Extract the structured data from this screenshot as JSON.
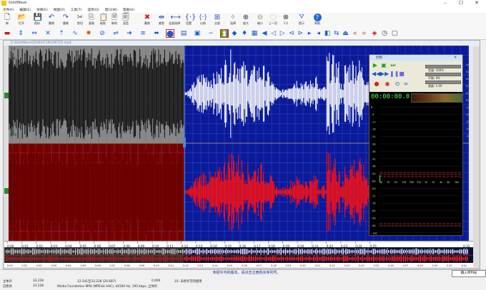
{
  "window": {
    "title": "GoldWave"
  },
  "menu": [
    "文件(F)",
    "编辑(E)",
    "效果(E)",
    "视图(V)",
    "工具(T)",
    "选项(O)",
    "窗口(W)",
    "帮助(H)"
  ],
  "toolbar1": [
    {
      "label": "新",
      "icon": "new-icon",
      "glyph": "🗋",
      "color": "#444"
    },
    {
      "label": "打开",
      "icon": "open-icon",
      "glyph": "📂",
      "color": "#c89020"
    },
    {
      "label": "保存",
      "icon": "save-icon",
      "glyph": "💾",
      "color": "#1a3a9a"
    },
    {
      "label": "撤销",
      "icon": "undo-icon",
      "glyph": "↶",
      "color": "#2a5ab0"
    },
    {
      "label": "重做",
      "icon": "redo-icon",
      "glyph": "↷",
      "color": "#2a5ab0"
    },
    {
      "label": "剪切",
      "icon": "cut-icon",
      "glyph": "✂",
      "color": "#555"
    },
    {
      "label": "复制",
      "icon": "copy-icon",
      "glyph": "⎘",
      "color": "#555"
    },
    {
      "label": "粘贴",
      "icon": "paste-icon",
      "glyph": "📋",
      "color": "#666"
    },
    {
      "label": "新的",
      "icon": "paste-new-icon",
      "glyph": "🗎",
      "color": "#666"
    },
    {
      "label": "混音",
      "icon": "mix-icon",
      "glyph": "🗐",
      "color": "#666"
    },
    {
      "label": "删除",
      "icon": "delete-icon",
      "glyph": "✖",
      "color": "#d02020"
    },
    {
      "label": "裁剪",
      "icon": "trim-icon",
      "glyph": "⇹",
      "color": "#2050c0"
    },
    {
      "label": "全部选择",
      "icon": "select-all-icon",
      "glyph": "⟷",
      "color": "#2050c0"
    },
    {
      "label": "设置",
      "icon": "set-icon",
      "glyph": "{·}",
      "color": "#2050c0"
    },
    {
      "label": "以前",
      "icon": "previous-icon",
      "glyph": "⟨·⟩",
      "color": "#2050c0"
    },
    {
      "label": "全部",
      "icon": "all-icon",
      "glyph": "⊞",
      "color": "#2050c0"
    },
    {
      "label": "选择",
      "icon": "select-icon",
      "glyph": "✧",
      "color": "#888"
    },
    {
      "label": "放大",
      "icon": "zoom-in-icon",
      "glyph": "⊕",
      "color": "#333"
    },
    {
      "label": "缩小",
      "icon": "zoom-out-icon",
      "glyph": "⊖",
      "color": "#888"
    },
    {
      "label": "上一页",
      "icon": "page-up-icon",
      "glyph": "◌",
      "color": "#aaa"
    },
    {
      "label": "1:1",
      "icon": "zoom-one-icon",
      "glyph": "⊗",
      "color": "#333"
    },
    {
      "label": "提示",
      "icon": "cue-icon",
      "glyph": "⛛",
      "color": "#2a6ad0"
    },
    {
      "label": "帮助",
      "icon": "help-icon",
      "glyph": "?",
      "color": "#fff"
    }
  ],
  "toolbar2_icons": [
    "record-icon",
    "stereo-icon",
    "channel-icon",
    "noise-icon",
    "pitch-icon",
    "loop-icon",
    "equalizer-icon",
    "filter-icon",
    "flip-icon",
    "play-right-icon",
    "mix-bars-icon",
    "compress-icon",
    "fade-icon",
    "volume-bars-icon",
    "level-icon",
    "wave-icon",
    "split-icon",
    "marker-icon",
    "shape-icon",
    "spectrum-icon",
    "speaker-icon",
    "speaker-left-icon",
    "speaker-right-icon",
    "mute-icon",
    "mono-icon",
    "left-icon",
    "right-icon",
    "swap-icon",
    "reverse-icon",
    "eject-icon",
    "back-icon",
    "forward-icon",
    "diamond-icon",
    "timer-icon",
    "stop-icon"
  ],
  "document": {
    "title": "E:\\GoldWave\\2019\\0719\\190725.mp4"
  },
  "control": {
    "title": "控制",
    "volume_label": "音量: 100%",
    "balance_label": "平衡: 0%",
    "speed_label": "速度: 1.00",
    "time": "00:00:00.0"
  },
  "wave": {
    "left_ticks": [
      "1.0",
      "0.8",
      "0.6",
      "0.4",
      "0.2",
      "0.0",
      "-0.2",
      "-0.4",
      "-0.6",
      "-0.8"
    ],
    "right_ticks": [
      "1.0",
      "0.8",
      "0.6",
      "0.4",
      "0.2",
      "0.0",
      "-0.2",
      "-0.4",
      "-0.6",
      "-0.8",
      "-1.0"
    ]
  },
  "meter": {
    "db_labels": [
      "0",
      "-6",
      "-12",
      "-18",
      "-24",
      "-30",
      "-36",
      "-42",
      "-48",
      "-54",
      "-60",
      "-66",
      "-72",
      "-78",
      "-84",
      "-90",
      "-96",
      "-102"
    ],
    "freq_labels": [
      "16",
      "32",
      "64",
      "128",
      "256",
      "512",
      "1k",
      "2k",
      "4k",
      "8k",
      "16k"
    ]
  },
  "ruler_ticks": [
    "0:00",
    "0:01",
    "0:02",
    "0:03",
    "0:04",
    "0:05",
    "0:06",
    "0:07",
    "0:08",
    "0:09",
    "0:10",
    "0:11",
    "0:12",
    "0:13",
    "0:14",
    "0:15",
    "0:16",
    "0:17",
    "0:18",
    "0:19",
    "0:20",
    "0:21",
    "0:22",
    "0:23",
    "0:24",
    "0:25"
  ],
  "ruler_end": "0:32",
  "ruler2_ticks": [
    "0:00",
    "0:01",
    "0:02",
    "0:03",
    "0:04",
    "0:05",
    "0:06",
    "0:07",
    "0:08",
    "0:09",
    "0:10",
    "0:11",
    "0:12",
    "0:13",
    "0:14",
    "0:15",
    "0:16",
    "0:17",
    "0:18",
    "0:19",
    "0:20",
    "0:21",
    "0:22",
    "0:23",
    "0:24",
    "0:25",
    "0:26",
    "0:27",
    "0:28",
    "0:29",
    "0:30",
    "0:31"
  ],
  "status": {
    "notice": "未经许可的版本。请点击注册购买序列号。",
    "enter_serial": "输入序列号",
    "stereo_label": "立体声",
    "stereo_val": "33.228",
    "range": "12.541至33.228 (20.687)",
    "pos": "0.000",
    "unlicensed": "10: 未经许可的使用",
    "modified_label": "已修改",
    "modified_val": "33.228",
    "format": "Media Foundation MP4 (MPEG4 AAC), 44100 Hz, 195 kbps, 立体声"
  },
  "colors": {
    "wave_bg": "#0a1a9a",
    "left_wave": "#ffffff",
    "right_wave": "#ff1010",
    "sel_left": "#1a1a1a",
    "sel_right": "#8a0000",
    "grid": "#3a5ad0",
    "sel_grid": "#9a9a9a"
  }
}
